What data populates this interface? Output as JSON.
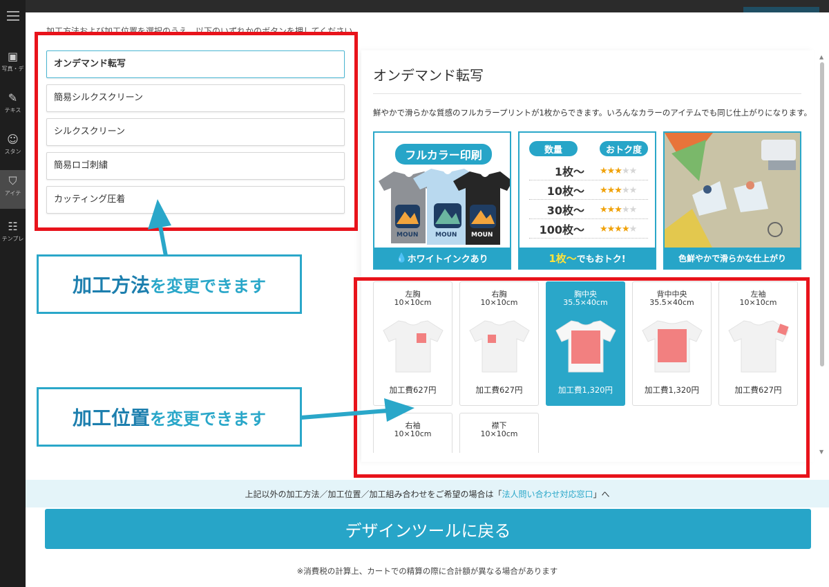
{
  "sidebar": {
    "items": [
      {
        "label": "写真・デ",
        "icon": "image-icon"
      },
      {
        "label": "テキス",
        "icon": "pen-icon"
      },
      {
        "label": "スタン",
        "icon": "stamp-icon"
      },
      {
        "label": "アイテ",
        "icon": "tshirt-icon"
      },
      {
        "label": "テンプレ",
        "icon": "template-icon"
      }
    ]
  },
  "instruction": "加工方法および加工位置を選択のうえ、以下のいずれかのボタンを押してください。",
  "methods": [
    {
      "label": "オンデマンド転写",
      "selected": true
    },
    {
      "label": "簡易シルクスクリーン",
      "selected": false
    },
    {
      "label": "シルクスクリーン",
      "selected": false
    },
    {
      "label": "簡易ロゴ刺繍",
      "selected": false
    },
    {
      "label": "カッティング圧着",
      "selected": false
    }
  ],
  "callouts": {
    "method": {
      "strong": "加工方法",
      "rest": "を変更できます"
    },
    "position": {
      "strong": "加工位置",
      "rest": "を変更できます"
    }
  },
  "detail": {
    "title": "オンデマンド転写",
    "description": "鮮やかで滑らかな質感のフルカラープリントが1枚からできます。いろんなカラーのアイテムでも同じ仕上がりになります。",
    "features": {
      "full_color": {
        "badge": "フルカラー印刷",
        "tshirt_text": "MOUN",
        "footer": "ホワイトインクあり"
      },
      "quantity": {
        "header_qty": "数量",
        "header_value": "おトク度",
        "rows": [
          {
            "qty": "1枚～",
            "stars": 3
          },
          {
            "qty": "10枚～",
            "stars": 3
          },
          {
            "qty": "30枚～",
            "stars": 3
          },
          {
            "qty": "100枚～",
            "stars": 4
          }
        ],
        "footer_highlight": "1枚～",
        "footer_rest": "でもおトク!"
      },
      "quality": {
        "footer": "色鮮やかで滑らかな仕上がり"
      }
    }
  },
  "positions": [
    {
      "name": "左胸",
      "size": "10×10cm",
      "price": "加工費627円",
      "selected": false
    },
    {
      "name": "右胸",
      "size": "10×10cm",
      "price": "加工費627円",
      "selected": false
    },
    {
      "name": "胸中央",
      "size": "35.5×40cm",
      "price": "加工費1,320円",
      "selected": true
    },
    {
      "name": "背中中央",
      "size": "35.5×40cm",
      "price": "加工費1,320円",
      "selected": false
    },
    {
      "name": "左袖",
      "size": "10×10cm",
      "price": "加工費627円",
      "selected": false
    },
    {
      "name": "右袖",
      "size": "10×10cm",
      "price": "",
      "selected": false
    },
    {
      "name": "襟下",
      "size": "10×10cm",
      "price": "",
      "selected": false
    }
  ],
  "notice": {
    "before": "上記以外の加工方法／加工位置／加工組み合わせをご希望の場合は「",
    "link": "法人問い合わせ対応窓口",
    "after": "」へ"
  },
  "return_button": "デザインツールに戻る",
  "footnote": "※消費税の計算上、カートでの精算の際に合計額が異なる場合があります",
  "colors": {
    "accent": "#27a5c8",
    "highlight_red": "#e8131b",
    "print_area": "#f28080",
    "star": "#f0a20a"
  }
}
